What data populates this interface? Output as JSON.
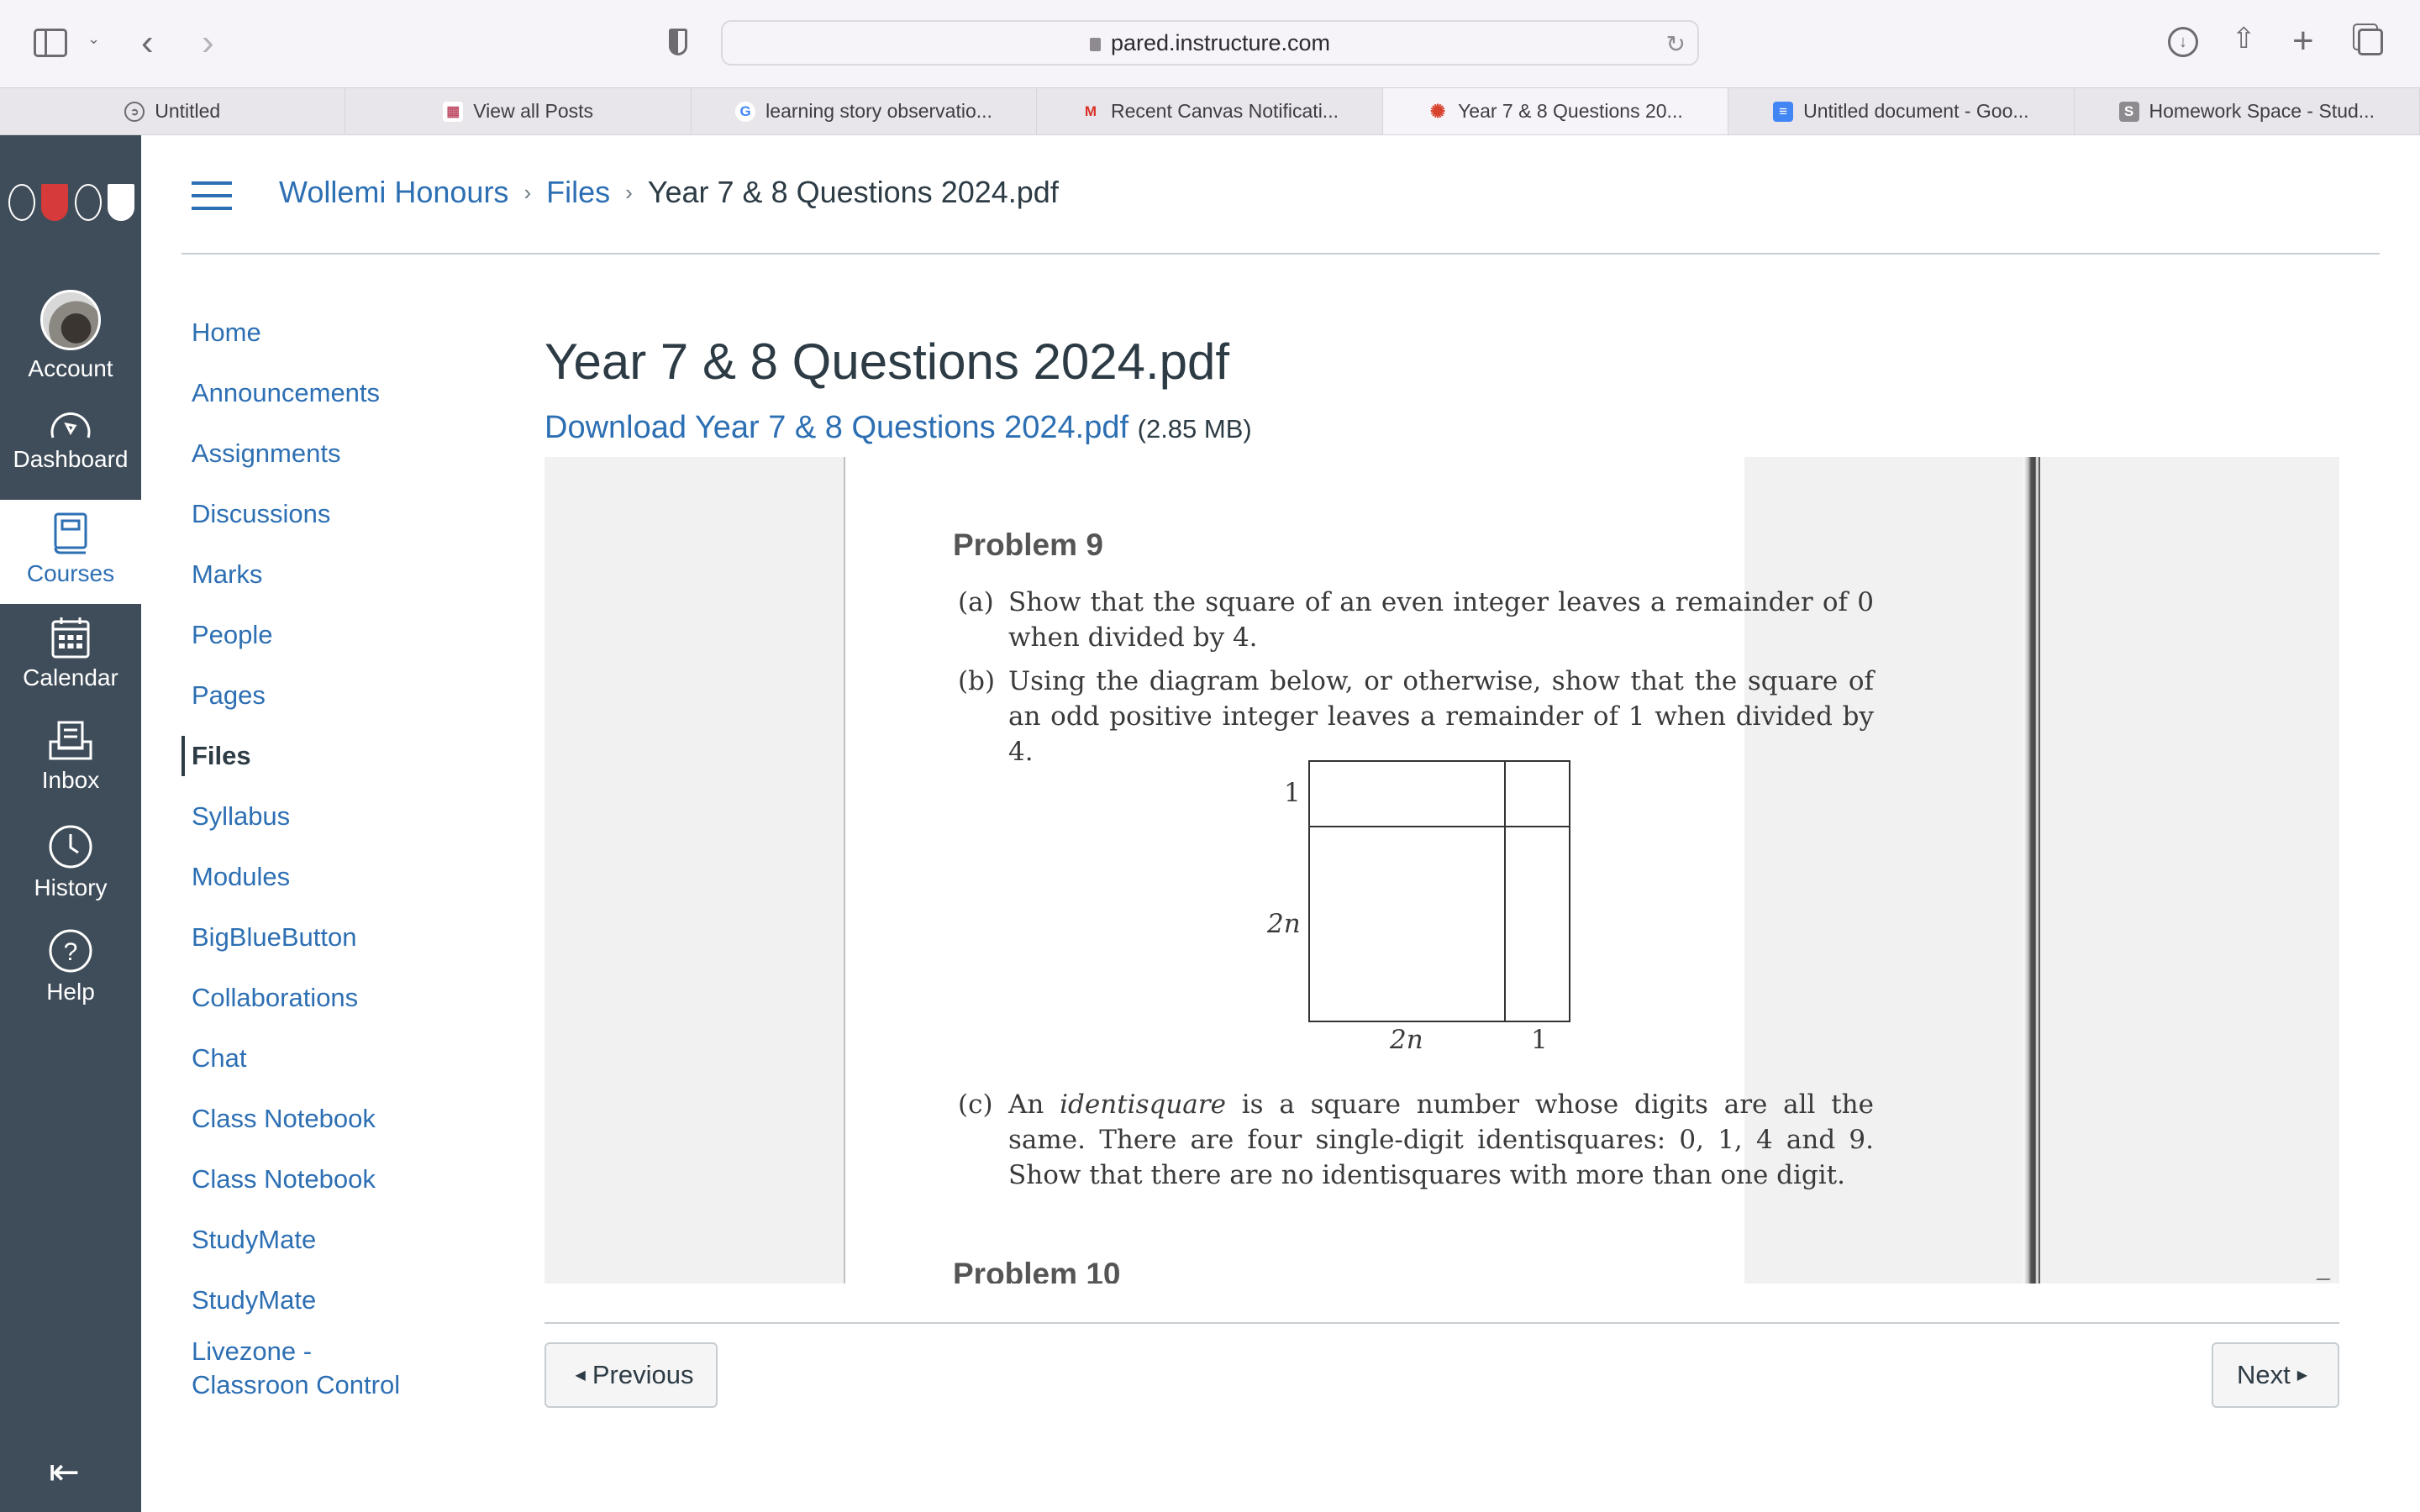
{
  "browser": {
    "url": "pared.instructure.com",
    "tabs": [
      {
        "label": "Untitled",
        "icon": "compass-icon",
        "active": false
      },
      {
        "label": "View all Posts",
        "icon": "blog-favicon",
        "active": false
      },
      {
        "label": "learning story observatio...",
        "icon": "google-favicon",
        "active": false
      },
      {
        "label": "Recent Canvas Notificati...",
        "icon": "gmail-favicon",
        "active": false
      },
      {
        "label": "Year 7 & 8 Questions 20...",
        "icon": "canvas-favicon",
        "active": true
      },
      {
        "label": "Untitled document - Goo...",
        "icon": "google-docs-favicon",
        "active": false
      },
      {
        "label": "Homework Space - Stud...",
        "icon": "studocu-favicon",
        "active": false
      }
    ]
  },
  "global_nav": {
    "logos": [
      "Tangara",
      "Redfield",
      "Montgrove",
      "Wollemi"
    ],
    "items": [
      {
        "label": "Account",
        "icon": "avatar"
      },
      {
        "label": "Dashboard",
        "icon": "dashboard-icon"
      },
      {
        "label": "Courses",
        "icon": "courses-icon",
        "active": true
      },
      {
        "label": "Calendar",
        "icon": "calendar-icon"
      },
      {
        "label": "Inbox",
        "icon": "inbox-icon"
      },
      {
        "label": "History",
        "icon": "history-icon"
      },
      {
        "label": "Help",
        "icon": "help-icon"
      }
    ]
  },
  "breadcrumb": {
    "course": "Wollemi Honours",
    "section": "Files",
    "current": "Year 7 & 8 Questions 2024.pdf"
  },
  "course_nav": [
    "Home",
    "Announcements",
    "Assignments",
    "Discussions",
    "Marks",
    "People",
    "Pages",
    "Files",
    "Syllabus",
    "Modules",
    "BigBlueButton",
    "Collaborations",
    "Chat",
    "Class Notebook",
    "Class Notebook",
    "StudyMate",
    "StudyMate",
    "Livezone - Classroon Control"
  ],
  "course_nav_active": "Files",
  "main": {
    "title": "Year 7 & 8 Questions 2024.pdf",
    "download_label": "Download Year 7 & 8 Questions 2024.pdf",
    "file_size": "(2.85 MB)"
  },
  "pdf": {
    "problem_title": "Problem 9",
    "parts": [
      {
        "tag": "(a)",
        "text": "Show that the square of an even integer leaves a remainder of 0 when divided by 4."
      },
      {
        "tag": "(b)",
        "text": "Using the diagram below, or otherwise, show that the square of an odd positive integer leaves a remainder of 1 when divided by 4."
      },
      {
        "tag": "(c)",
        "text_before": "An ",
        "emph": "identisquare",
        "text_after": " is a square number whose digits are all the same. There are four single-digit identisquares: 0, 1, 4 and 9. Show that there are no identisquares with more than one digit."
      }
    ],
    "diagram_labels": {
      "left_top": "1",
      "left_bottom": "2n",
      "bottom_left": "2n",
      "bottom_right": "1"
    },
    "next_problem_title": "Problem 10"
  },
  "pager": {
    "previous": "Previous",
    "next": "Next"
  }
}
